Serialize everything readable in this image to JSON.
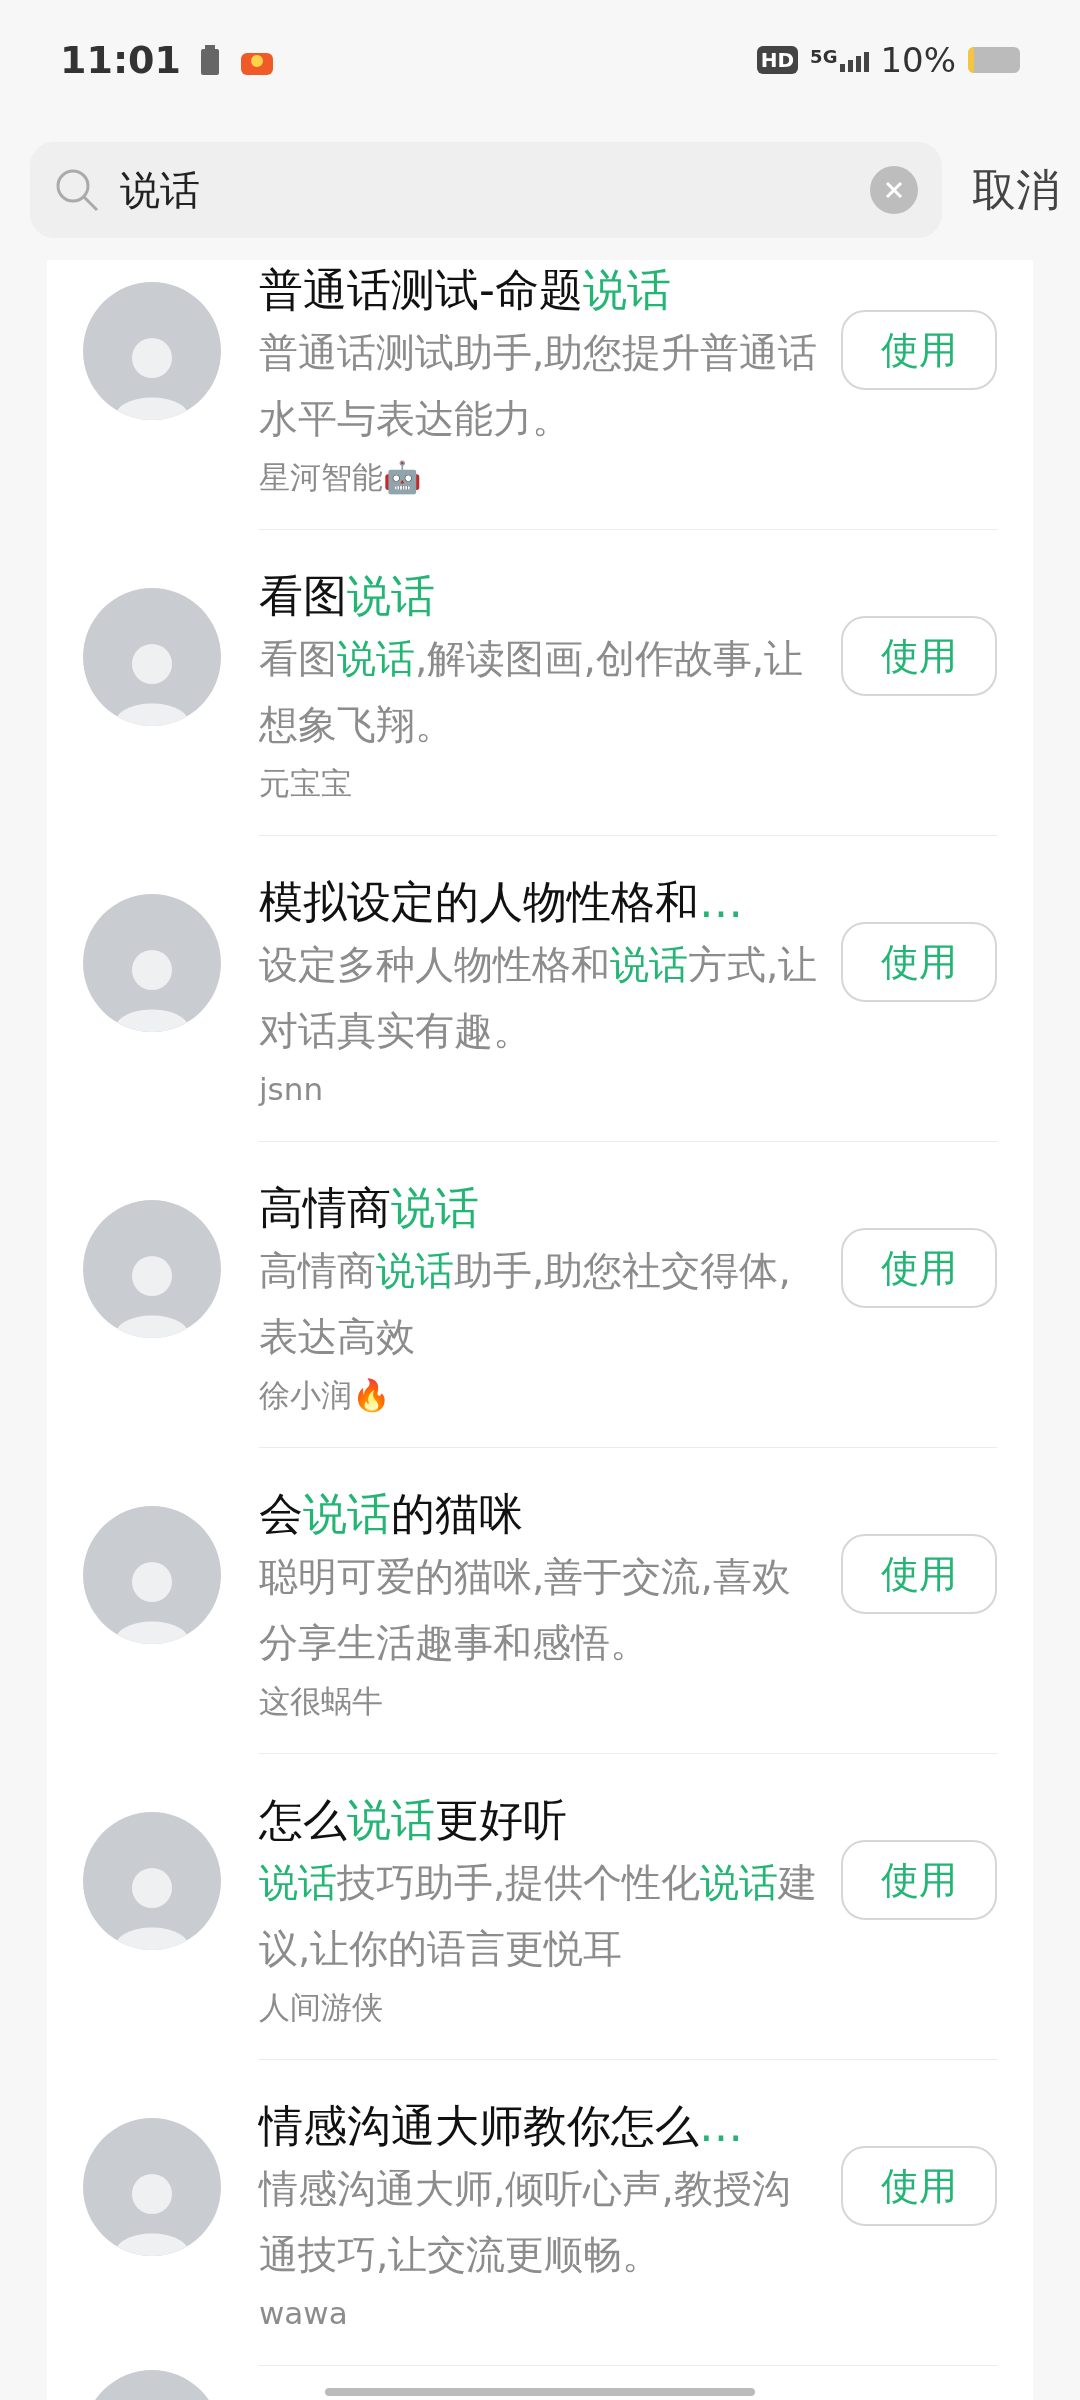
{
  "status_bar": {
    "time": "11:01",
    "hd": "HD",
    "network": "5G",
    "battery": "10%"
  },
  "search": {
    "value": "说话",
    "cancel": "取消"
  },
  "results": [
    {
      "title": [
        {
          "text": "普通话测试-命题",
          "highlight": false
        },
        {
          "text": "说话",
          "highlight": true
        }
      ],
      "description": [
        {
          "text": "普通话测试助手,助您提升普通话水平与表达能力。",
          "highlight": false
        }
      ],
      "author": "星河智能🤖",
      "button": "使用"
    },
    {
      "title": [
        {
          "text": "看图",
          "highlight": false
        },
        {
          "text": "说话",
          "highlight": true
        }
      ],
      "description": [
        {
          "text": "看图",
          "highlight": false
        },
        {
          "text": "说话",
          "highlight": true
        },
        {
          "text": ",解读图画,创作故事,让想象飞翔。",
          "highlight": false
        }
      ],
      "author": "元宝宝",
      "button": "使用"
    },
    {
      "title": [
        {
          "text": "模拟设定的人物性格和",
          "highlight": false
        },
        {
          "text": "…",
          "highlight": true
        }
      ],
      "description": [
        {
          "text": "设定多种人物性格和",
          "highlight": false
        },
        {
          "text": "说话",
          "highlight": true
        },
        {
          "text": "方式,让对话真实有趣。",
          "highlight": false
        }
      ],
      "author": "jsnn",
      "button": "使用"
    },
    {
      "title": [
        {
          "text": "高情商",
          "highlight": false
        },
        {
          "text": "说话",
          "highlight": true
        }
      ],
      "description": [
        {
          "text": "高情商",
          "highlight": false
        },
        {
          "text": "说话",
          "highlight": true
        },
        {
          "text": "助手,助您社交得体,表达高效",
          "highlight": false
        }
      ],
      "author": "徐小润🔥",
      "button": "使用"
    },
    {
      "title": [
        {
          "text": "会",
          "highlight": false
        },
        {
          "text": "说话",
          "highlight": true
        },
        {
          "text": "的猫咪",
          "highlight": false
        }
      ],
      "description": [
        {
          "text": "聪明可爱的猫咪,善于交流,喜欢分享生活趣事和感悟。",
          "highlight": false
        }
      ],
      "author": "这很蜗牛",
      "button": "使用"
    },
    {
      "title": [
        {
          "text": "怎么",
          "highlight": false
        },
        {
          "text": "说话",
          "highlight": true
        },
        {
          "text": "更好听",
          "highlight": false
        }
      ],
      "description": [
        {
          "text": "说话",
          "highlight": true
        },
        {
          "text": "技巧助手,提供个性化",
          "highlight": false
        },
        {
          "text": "说话",
          "highlight": true
        },
        {
          "text": "建议,让你的语言更悦耳",
          "highlight": false
        }
      ],
      "author": "人间游侠",
      "button": "使用"
    },
    {
      "title": [
        {
          "text": "情感沟通大师教你怎么",
          "highlight": false
        },
        {
          "text": "…",
          "highlight": true
        }
      ],
      "description": [
        {
          "text": "情感沟通大师,倾听心声,教授沟通技巧,让交流更顺畅。",
          "highlight": false
        }
      ],
      "author": "wawa",
      "button": "使用"
    }
  ]
}
